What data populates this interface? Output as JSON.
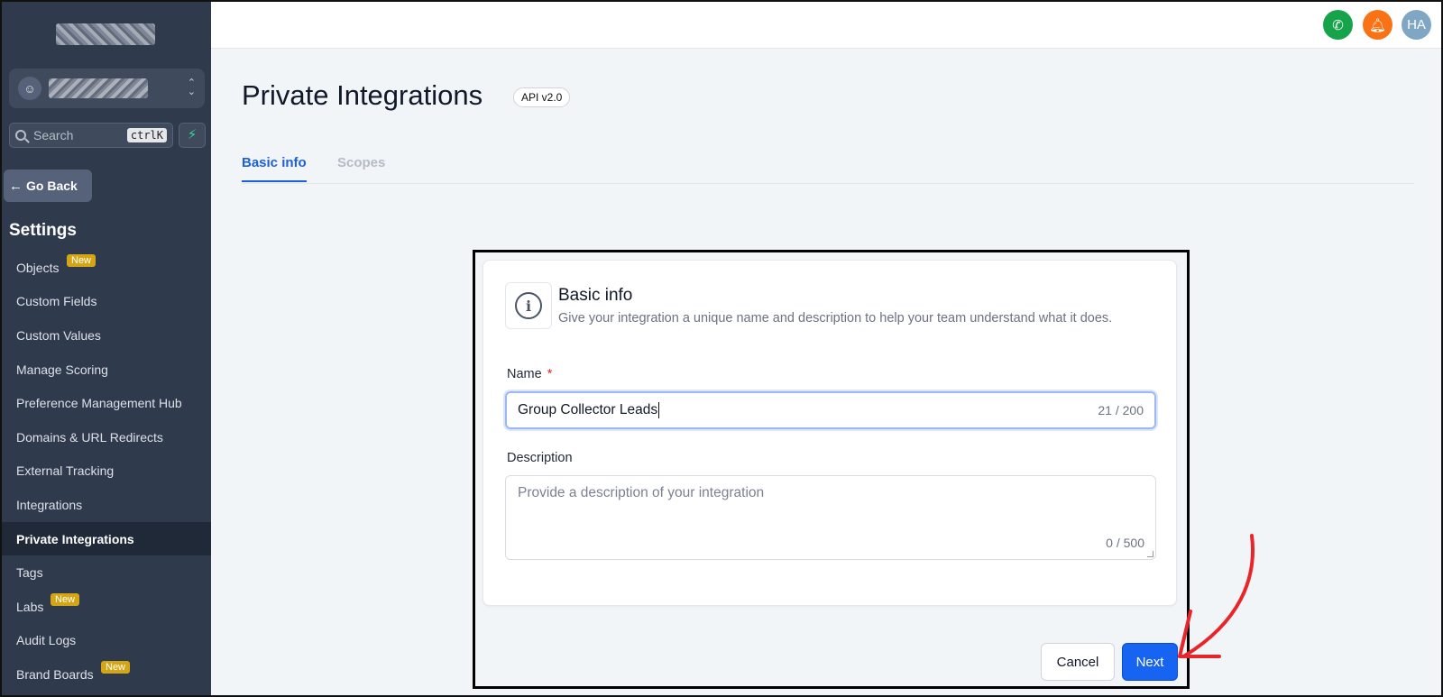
{
  "sidebar": {
    "search_placeholder": "Search",
    "search_shortcut": "ctrlK",
    "go_back": "Go Back",
    "section_title": "Settings",
    "items": [
      {
        "label": "Objects",
        "badge": "New"
      },
      {
        "label": "Custom Fields"
      },
      {
        "label": "Custom Values"
      },
      {
        "label": "Manage Scoring"
      },
      {
        "label": "Preference Management Hub"
      },
      {
        "label": "Domains & URL Redirects"
      },
      {
        "label": "External Tracking"
      },
      {
        "label": "Integrations"
      },
      {
        "label": "Private Integrations",
        "active": true
      },
      {
        "label": "Tags"
      },
      {
        "label": "Labs",
        "badge": "New"
      },
      {
        "label": "Audit Logs"
      },
      {
        "label": "Brand Boards",
        "badge": "New"
      }
    ]
  },
  "topbar": {
    "phone_color": "#16a34a",
    "bell_color": "#f97316",
    "avatar_initials": "HA",
    "avatar_color": "#7fa7c4"
  },
  "page": {
    "title": "Private Integrations",
    "api_badge": "API v2.0",
    "tabs": [
      {
        "label": "Basic info",
        "active": true
      },
      {
        "label": "Scopes",
        "active": false
      }
    ]
  },
  "card": {
    "title": "Basic info",
    "subtitle": "Give your integration a unique name and description to help your team understand what it does.",
    "name_label": "Name",
    "required_mark": "*",
    "name_value": "Group Collector Leads",
    "name_count": "21 / 200",
    "description_label": "Description",
    "description_placeholder": "Provide a description of your integration",
    "description_count": "0 / 500"
  },
  "actions": {
    "cancel": "Cancel",
    "next": "Next"
  },
  "colors": {
    "accent": "#1864f2",
    "annotation_arrow": "#e8262a"
  }
}
